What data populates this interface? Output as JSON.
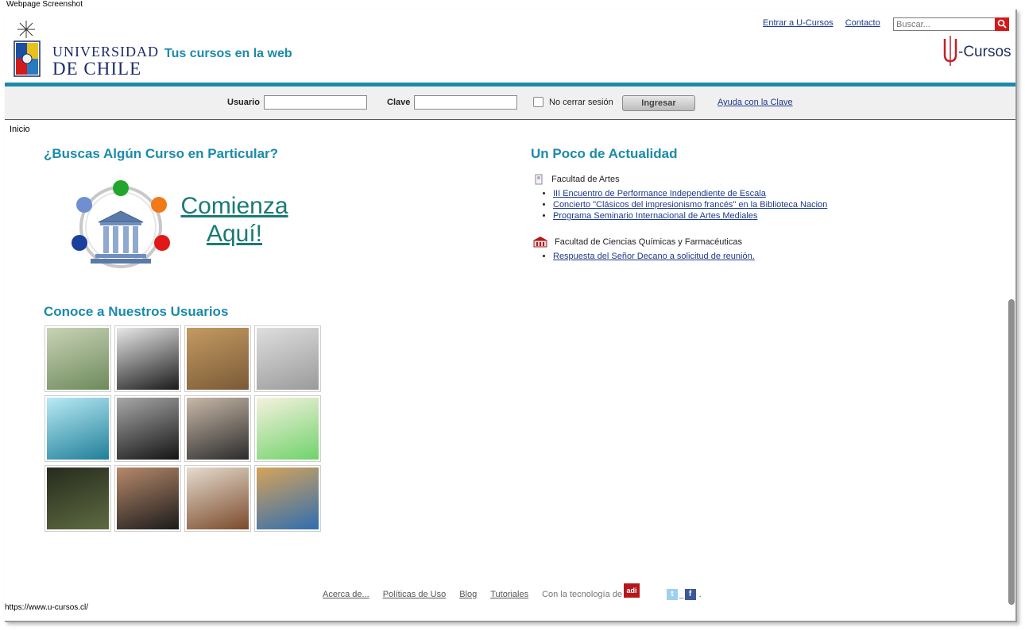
{
  "caption": "Webpage Screenshot",
  "header": {
    "logo_line1": "UNIVERSIDAD",
    "logo_line2": "DE CHILE",
    "tagline": "Tus cursos en la web",
    "links": [
      "Entrar a U-Cursos",
      "Contacto"
    ],
    "search_placeholder": "Buscar...",
    "brand": "-Cursos"
  },
  "login": {
    "user_label": "Usuario",
    "pass_label": "Clave",
    "remember_label": "No cerrar sesión",
    "submit_label": "Ingresar",
    "help_link": "Ayuda con la Clave"
  },
  "breadcrumb": "Inicio",
  "left": {
    "search_title": "¿Buscas Algún Curso en Particular?",
    "cta_line1": "Comienza",
    "cta_line2": "Aquí!",
    "users_title": "Conoce a Nuestros Usuarios"
  },
  "news": {
    "title": "Un Poco de Actualidad",
    "groups": [
      {
        "faculty": "Facultad de Artes",
        "items": [
          "III Encuentro de Performance Independiente de Escala",
          "Concierto \"Clásicos del impresionismo francés\" en la Biblioteca Nacion",
          "Programa Seminario Internacional de Artes Mediales"
        ]
      },
      {
        "faculty": "Facultad de Ciencias Químicas y Farmacéuticas",
        "items": [
          "Respuesta del Señor Decano a solicitud de reunión."
        ]
      }
    ]
  },
  "avatars": [
    {
      "colors": [
        "#6d8a5a",
        "#c9d3b7"
      ]
    },
    {
      "colors": [
        "#1a1a1a",
        "#e8e8e8"
      ]
    },
    {
      "colors": [
        "#7a5a36",
        "#c49a62"
      ]
    },
    {
      "colors": [
        "#9a9a9a",
        "#dedede"
      ]
    },
    {
      "colors": [
        "#1f7f99",
        "#b9eaf5"
      ]
    },
    {
      "colors": [
        "#141414",
        "#a8a8a8"
      ]
    },
    {
      "colors": [
        "#2b2b2b",
        "#c9b9a8"
      ]
    },
    {
      "colors": [
        "#6fd36a",
        "#f6f1df"
      ]
    },
    {
      "colors": [
        "#5e6b41",
        "#262b1d"
      ]
    },
    {
      "colors": [
        "#1b1b1b",
        "#b7896a"
      ]
    },
    {
      "colors": [
        "#7b4a2a",
        "#e5dccf"
      ]
    },
    {
      "colors": [
        "#2f6eb0",
        "#d6a35a"
      ]
    }
  ],
  "footer": {
    "links": [
      "Acerca de...",
      "Políticas de Uso",
      "Blog",
      "Tutoriales"
    ],
    "tech_text": "Con la tecnología de",
    "tech_logo": "adi",
    "twitter_icon": "t",
    "facebook_icon": "f",
    "sep": "_",
    "dot": "."
  },
  "status_url": "https://www.u-cursos.cl/",
  "colors": {
    "accent": "#1c8aaa",
    "cta": "#1a7a74",
    "link": "#1c3a8a"
  }
}
